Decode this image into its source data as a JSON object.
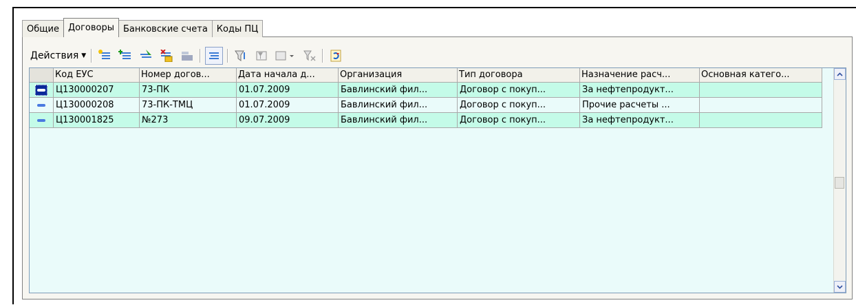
{
  "tabs": [
    {
      "label": "Общие",
      "active": false
    },
    {
      "label": "Договоры",
      "active": true
    },
    {
      "label": "Банковские счета",
      "active": false
    },
    {
      "label": "Коды ПЦ",
      "active": false
    }
  ],
  "toolbar": {
    "actions_label": "Действия",
    "icons": [
      "add-icon",
      "add-group-icon",
      "copy-icon",
      "delete-icon",
      "ok-icon",
      "hierarchy-icon",
      "filter-icon",
      "filter-list-icon",
      "filter-dropdown-icon",
      "clear-filter-icon",
      "refresh-icon"
    ]
  },
  "table": {
    "columns": [
      "",
      "Код ЕУС",
      "Номер догов...",
      "Дата начала д...",
      "Организация",
      "Тип договора",
      "Назначение расч...",
      "Основная катего..."
    ],
    "rows": [
      [
        "Ц130000207",
        "73-ПК",
        "01.07.2009",
        "Бавлинский фил...",
        "Договор с покуп...",
        "За нефтепродукт...",
        ""
      ],
      [
        "Ц130000208",
        "73-ПК-ТМЦ",
        "01.07.2009",
        "Бавлинский фил...",
        "Договор с покуп...",
        "Прочие расчеты ...",
        ""
      ],
      [
        "Ц130001825",
        "№273",
        "09.07.2009",
        "Бавлинский фил...",
        "Договор с покуп...",
        "За нефтепродукт...",
        ""
      ]
    ]
  },
  "colors": {
    "row_selected": "#c4fbe8",
    "row_alt": "#eafbfa",
    "grid_bg": "#eafbfa"
  }
}
